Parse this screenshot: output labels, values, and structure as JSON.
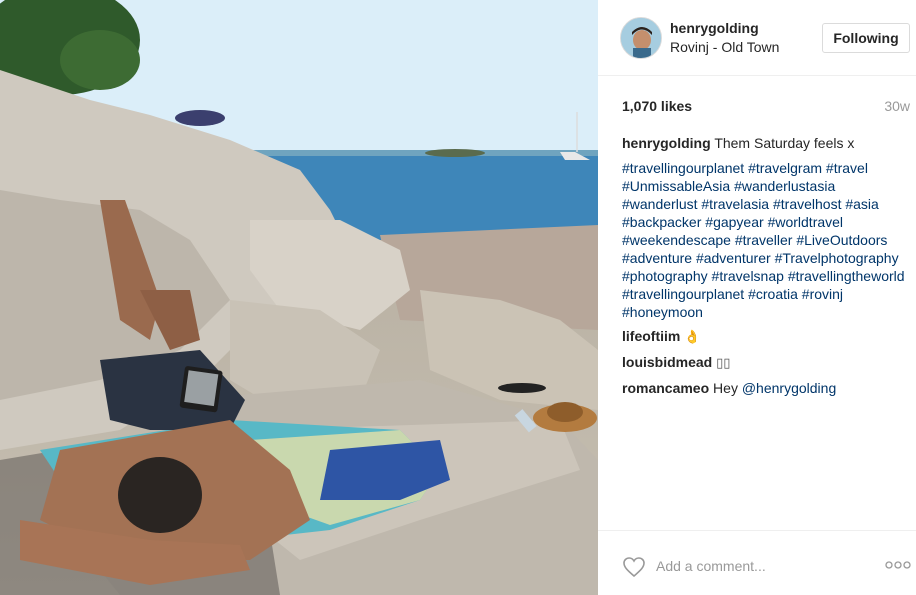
{
  "post": {
    "username": "henrygolding",
    "location": "Rovinj - Old Town",
    "follow_label": "Following",
    "likes": "1,070 likes",
    "time_ago": "30w"
  },
  "caption": {
    "author": "henrygolding",
    "text": "Them Saturday feels x",
    "hashtags": [
      "#travellingourplanet",
      "#travelgram",
      "#travel",
      "#UnmissableAsia",
      "#wanderlustasia",
      "#wanderlust",
      "#travelasia",
      "#travelhost",
      "#asia",
      "#backpacker",
      "#gapyear",
      "#worldtravel",
      "#weekendescape",
      "#traveller",
      "#LiveOutdoors",
      "#adventure",
      "#adventurer",
      "#Travelphotography",
      "#photography",
      "#travelsnap",
      "#travellingtheworld",
      "#travellingourplanet",
      "#croatia",
      "#rovinj",
      "#honeymoon"
    ]
  },
  "comments": [
    {
      "author": "lifeoftiim",
      "text": "👌"
    },
    {
      "author": "louisbidmead",
      "text": "▯▯"
    },
    {
      "author": "romancameo",
      "text": "Hey ",
      "mention": "@henrygolding"
    }
  ],
  "footer": {
    "comment_placeholder": "Add a comment...",
    "heart_icon": "heart-outline-icon",
    "more_icon": "more-dots-icon"
  },
  "colors": {
    "link": "#003569",
    "muted": "#999999",
    "text": "#262626"
  }
}
